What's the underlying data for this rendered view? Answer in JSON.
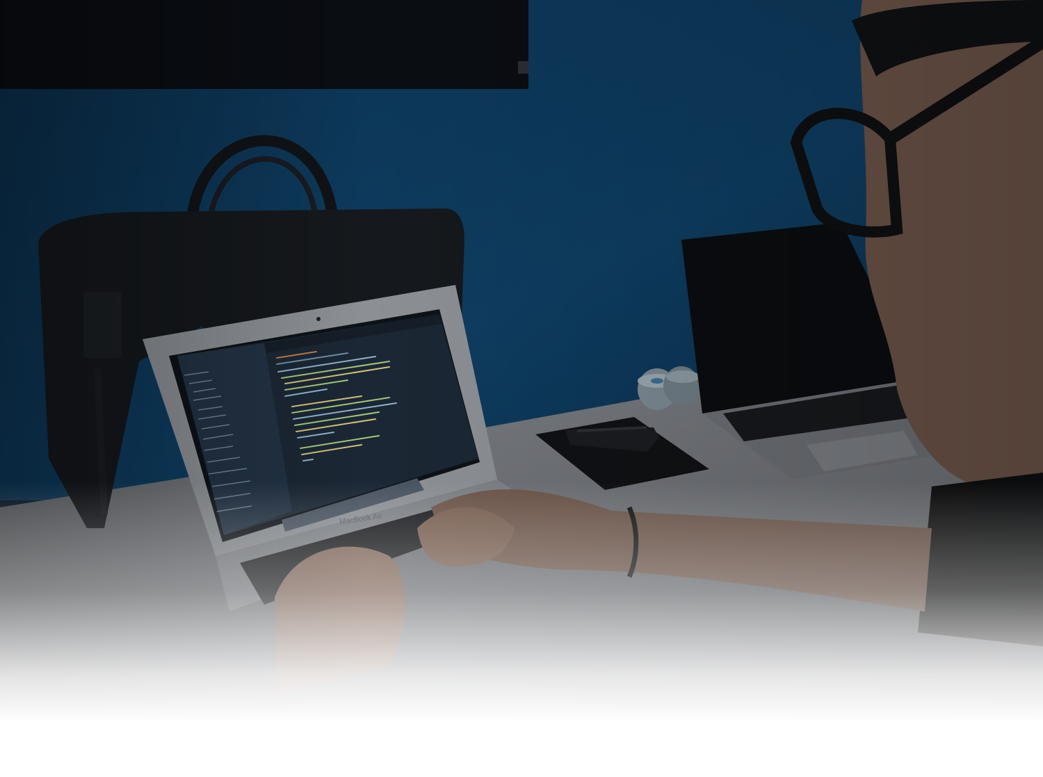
{
  "scene": {
    "colors": {
      "wall": "#0d3a5c",
      "wall_shadow": "#092a44",
      "desk": "#6d7076",
      "bag": "#15181c",
      "laptop_shell": "#8b8f94",
      "editor_bg": "#1b2734",
      "sidebar_bg": "#223244",
      "skin": "#6e564a",
      "shirt": "#0e0f10"
    },
    "laptop_label": "MacBook Air"
  }
}
